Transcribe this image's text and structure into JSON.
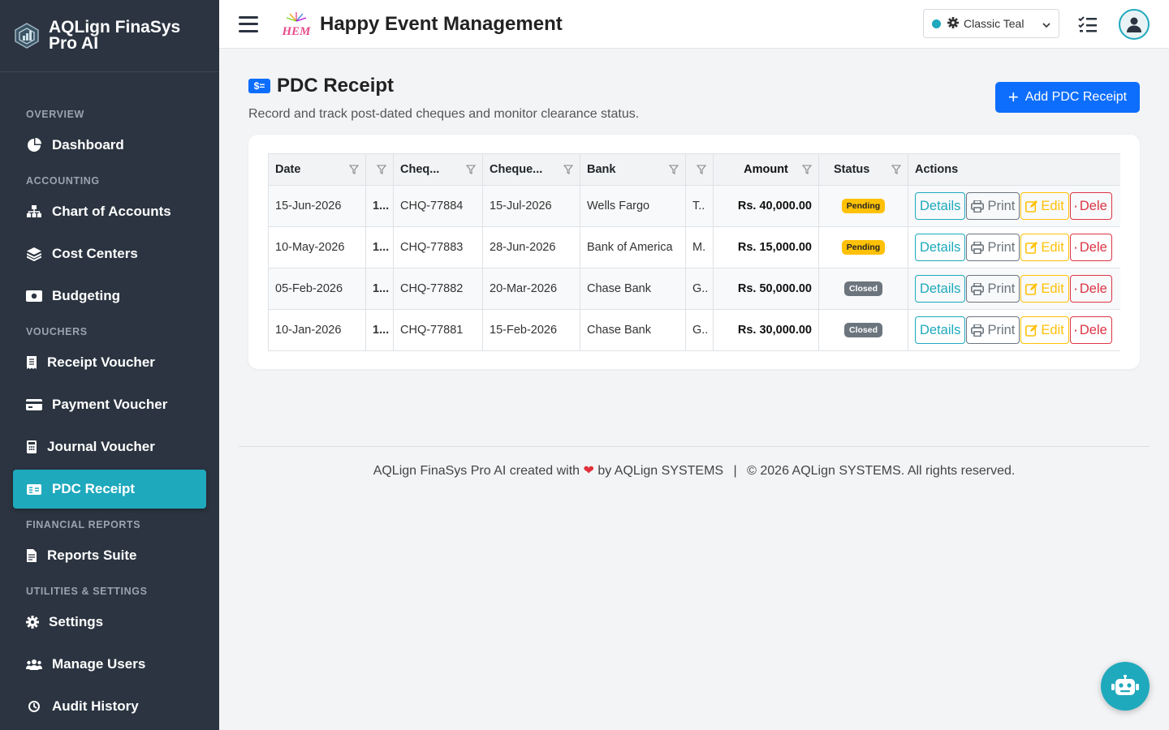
{
  "sidebar": {
    "brand": "AQLign FinaSys Pro AI",
    "sections": {
      "overview": "OVERVIEW",
      "accounting": "ACCOUNTING",
      "vouchers": "VOUCHERS",
      "financial_reports": "FINANCIAL REPORTS",
      "utilities": "UTILITIES & SETTINGS"
    },
    "items": {
      "dashboard": "Dashboard",
      "chart_of_accounts": "Chart of Accounts",
      "cost_centers": "Cost Centers",
      "budgeting": "Budgeting",
      "receipt_voucher": "Receipt Voucher",
      "payment_voucher": "Payment Voucher",
      "journal_voucher": "Journal Voucher",
      "pdc_receipt": "PDC Receipt",
      "reports_suite": "Reports Suite",
      "settings": "Settings",
      "manage_users": "Manage Users",
      "audit_history": "Audit History"
    },
    "active_item": "pdc_receipt",
    "colors": {
      "background": "#2b3440",
      "active": "#1ea9bd"
    }
  },
  "header": {
    "title": "Happy Event Management",
    "logo_text": "HEM",
    "theme": {
      "selected": "Classic Teal",
      "dot_color": "#1ea9bd"
    }
  },
  "page": {
    "title": "PDC Receipt",
    "subtitle": "Record and track post-dated cheques and monitor clearance status.",
    "icon_text": "$=",
    "add_button": "Add PDC Receipt"
  },
  "table": {
    "columns": {
      "date": "Date",
      "party": "",
      "cheque_no": "Cheq...",
      "cheque_date": "Cheque...",
      "bank": "Bank",
      "branch": "",
      "amount": "Amount",
      "status": "Status",
      "actions": "Actions"
    },
    "rows": [
      {
        "date": "15-Jun-2026",
        "party": "1...",
        "cheque_no": "CHQ-77884",
        "cheque_date": "15-Jul-2026",
        "bank": "Wells Fargo",
        "branch": "T..",
        "amount": "Rs. 40,000.00",
        "status": "Pending"
      },
      {
        "date": "10-May-2026",
        "party": "1...",
        "cheque_no": "CHQ-77883",
        "cheque_date": "28-Jun-2026",
        "bank": "Bank of America",
        "branch": "M.",
        "amount": "Rs. 15,000.00",
        "status": "Pending"
      },
      {
        "date": "05-Feb-2026",
        "party": "1...",
        "cheque_no": "CHQ-77882",
        "cheque_date": "20-Mar-2026",
        "bank": "Chase Bank",
        "branch": "G..",
        "amount": "Rs. 50,000.00",
        "status": "Closed"
      },
      {
        "date": "10-Jan-2026",
        "party": "1...",
        "cheque_no": "CHQ-77881",
        "cheque_date": "15-Feb-2026",
        "bank": "Chase Bank",
        "branch": "G..",
        "amount": "Rs. 30,000.00",
        "status": "Closed"
      }
    ],
    "actions": {
      "details": "Details",
      "print": "Print",
      "edit": "Edit",
      "delete": "Dele"
    },
    "status_colors": {
      "Pending": "#ffc107",
      "Closed": "#6c757d"
    }
  },
  "footer": {
    "left_prefix": "AQLign FinaSys Pro AI created with",
    "left_suffix": "by AQLign SYSTEMS",
    "separator": "|",
    "right": "© 2026 AQLign SYSTEMS. All rights reserved."
  }
}
